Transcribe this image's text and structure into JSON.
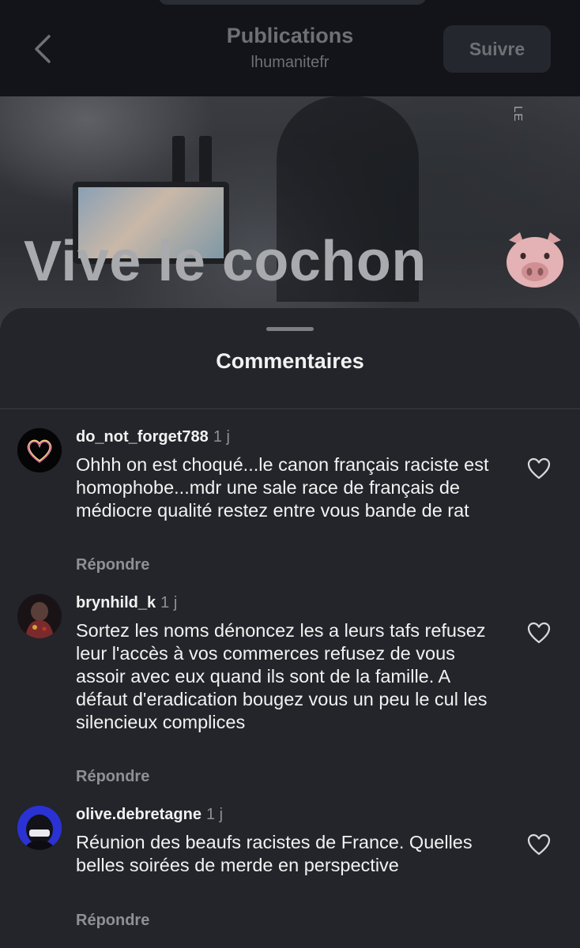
{
  "header": {
    "title": "Publications",
    "subtitle": "lhumanitefr",
    "follow_label": "Suivre"
  },
  "video": {
    "caption": "Vive le cochon",
    "corner_text": "LE",
    "emoji": "pig-face-icon"
  },
  "comments_sheet": {
    "title": "Commentaires",
    "comments": [
      {
        "username": "do_not_forget788",
        "time": "1 j",
        "text": "Ohhh on est choqué...le canon français raciste est homophobe...mdr une sale race de français de médiocre qualité restez entre vous bande de rat",
        "reply_label": "Répondre"
      },
      {
        "username": "brynhild_k",
        "time": "1 j",
        "text": "Sortez les noms dénoncez les a leurs tafs refusez leur l'accès à vos commerces refusez de vous assoir avec eux quand ils sont de la famille. A défaut d'eradication bougez vous un peu le cul les silencieux complices",
        "reply_label": "Répondre"
      },
      {
        "username": "olive.debretagne",
        "time": "1 j",
        "text": "Réunion des beaufs racistes de France. Quelles belles soirées de merde en perspective",
        "reply_label": "Répondre"
      }
    ]
  },
  "colors": {
    "header_bg": "#121419",
    "sheet_bg": "#23252a",
    "text_primary": "#f2f2f2",
    "text_secondary": "#8e9094"
  }
}
